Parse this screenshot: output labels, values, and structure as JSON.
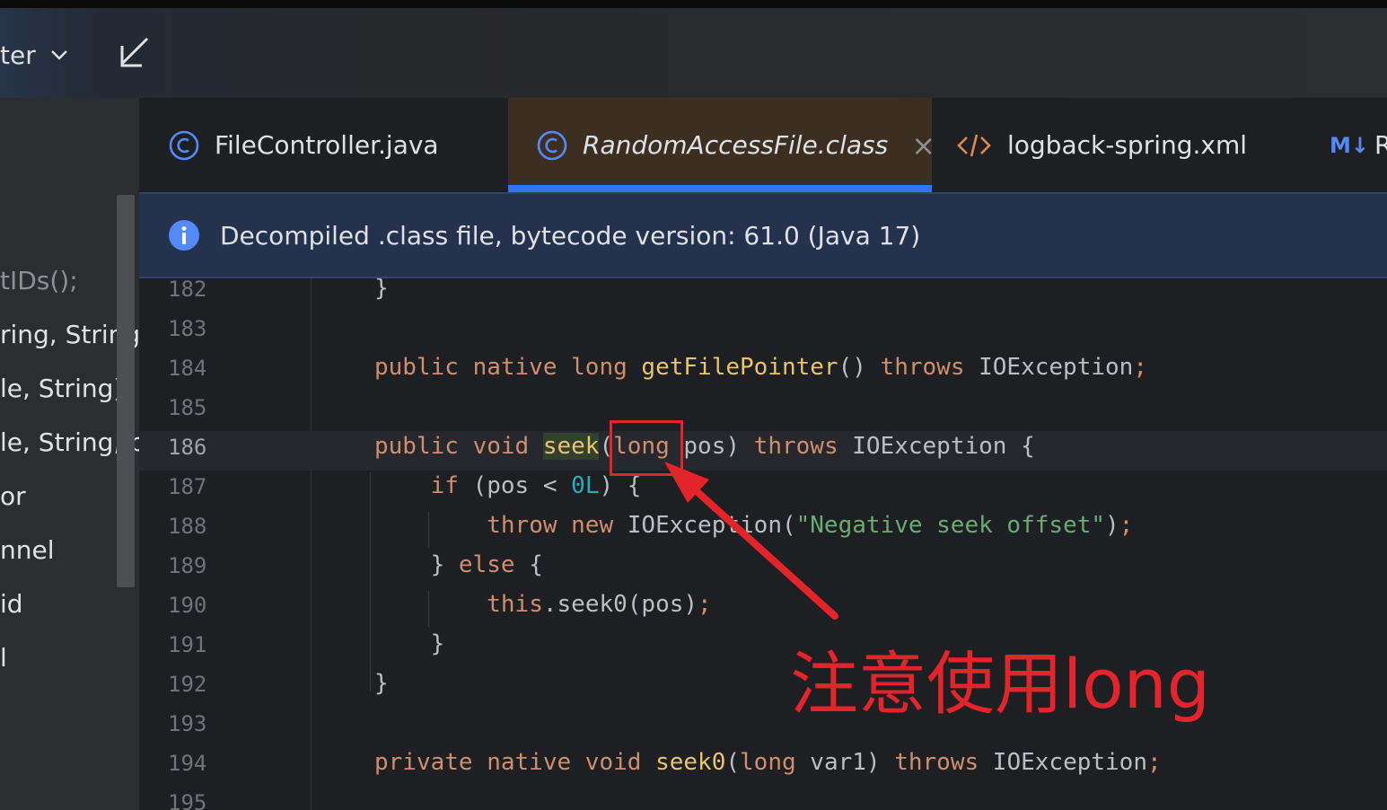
{
  "toolbar": {
    "partial_label": "ter"
  },
  "left_panel": {
    "items": [
      "tIDs();",
      "ring, String)",
      "le, String)",
      "le, String, bo",
      "or",
      "nnel",
      "id",
      "l"
    ]
  },
  "tabs": [
    {
      "label": "FileController.java",
      "icon": "java-class-icon",
      "active": false
    },
    {
      "label": "RandomAccessFile.class",
      "icon": "java-class-icon",
      "active": true,
      "close": "×"
    },
    {
      "label": "logback-spring.xml",
      "icon": "xml-icon",
      "active": false
    },
    {
      "label": "R",
      "icon": "markdown-icon",
      "icon_text": "M↓",
      "active": false
    }
  ],
  "banner": {
    "text": "Decompiled .class file, bytecode version: 61.0 (Java 17)"
  },
  "editor": {
    "current_line": "186",
    "lines": [
      {
        "n": "182",
        "code": "}"
      },
      {
        "n": "183",
        "code": ""
      },
      {
        "n": "184",
        "code": "public native long getFilePointer() throws IOException;"
      },
      {
        "n": "185",
        "code": ""
      },
      {
        "n": "186",
        "code": "public void seek(long pos) throws IOException {"
      },
      {
        "n": "187",
        "code": "    if (pos < 0L) {"
      },
      {
        "n": "188",
        "code": "        throw new IOException(\"Negative seek offset\");"
      },
      {
        "n": "189",
        "code": "    } else {"
      },
      {
        "n": "190",
        "code": "        this.seek0(pos);"
      },
      {
        "n": "191",
        "code": "    }"
      },
      {
        "n": "192",
        "code": "}"
      },
      {
        "n": "193",
        "code": ""
      },
      {
        "n": "194",
        "code": "private native void seek0(long var1) throws IOException;"
      },
      {
        "n": "195",
        "code": ""
      }
    ]
  },
  "annotation": {
    "text": "注意使用long",
    "color": "#e3252b"
  },
  "colors": {
    "accent": "#3574f0",
    "keyword": "#cf8e6d",
    "string": "#6aab73",
    "number": "#2aacb8",
    "annotation": "#e3252b"
  }
}
